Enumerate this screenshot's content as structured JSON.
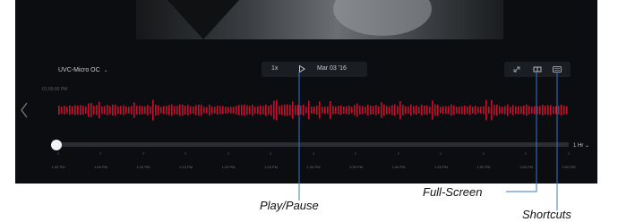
{
  "player": {
    "camera_name": "UVC-Micro OC",
    "speed": "1x",
    "date": "Mar 03 '16",
    "timestamp": "01:00:00 PM",
    "zoom": "1 Hr",
    "position_fraction": 0.0
  },
  "timeline": {
    "ticks": [
      "1:00 PM",
      "1:05 PM",
      "1:10 PM",
      "1:15 PM",
      "1:20 PM",
      "1:25 PM",
      "1:30 PM",
      "1:35 PM",
      "1:40 PM",
      "1:45 PM",
      "1:50 PM",
      "1:55 PM",
      "2:00 PM"
    ]
  },
  "annotations": {
    "play_pause": "Play/Pause",
    "full_screen": "Full-Screen",
    "shortcuts": "Shortcuts"
  },
  "colors": {
    "waveform": "#c8102e",
    "background": "#0b0d10"
  },
  "icons": [
    "chevron-down-icon",
    "play-icon",
    "resize-icon",
    "fullscreen-icon",
    "keyboard-icon",
    "chevron-left-icon",
    "chevron-right-icon"
  ]
}
